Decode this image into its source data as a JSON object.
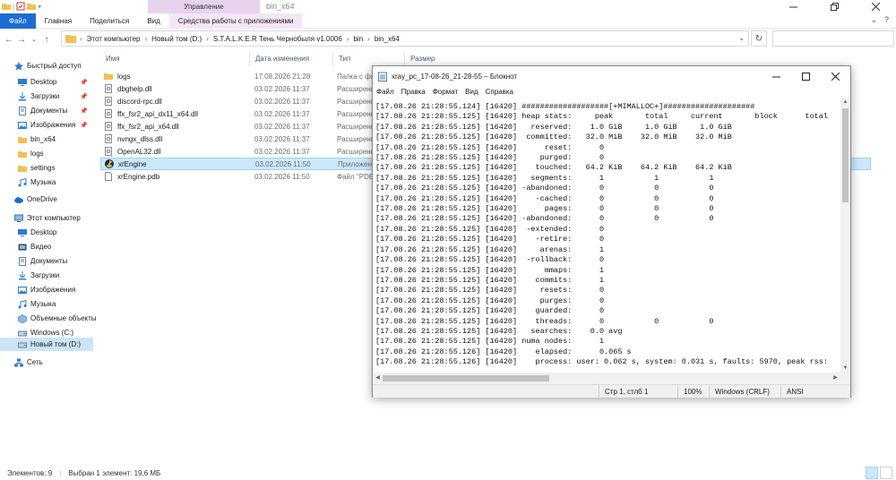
{
  "explorer": {
    "context_tab_title": "Управление",
    "window_title": "bin_x64",
    "ribbon_tabs": [
      "Файл",
      "Главная",
      "Поделиться",
      "Вид",
      "Средства работы с приложениями"
    ],
    "breadcrumb": [
      "Этот компьютер",
      "Новый том (D:)",
      "S.T.A.L.K.E.R Тень Чернобыля v1.0006",
      "bin",
      "bin_x64"
    ],
    "nav": [
      {
        "label": "Быстрый доступ",
        "icon": "star-icon",
        "pinned": false,
        "level": 0
      },
      {
        "label": "Desktop",
        "icon": "desktop-icon",
        "pinned": true,
        "level": 1
      },
      {
        "label": "Загрузки",
        "icon": "download-icon",
        "pinned": true,
        "level": 1
      },
      {
        "label": "Документы",
        "icon": "documents-icon",
        "pinned": true,
        "level": 1
      },
      {
        "label": "Изображения",
        "icon": "pictures-icon",
        "pinned": true,
        "level": 1
      },
      {
        "label": "bin_x64",
        "icon": "folder-icon",
        "pinned": false,
        "level": 1
      },
      {
        "label": "logs",
        "icon": "folder-icon",
        "pinned": false,
        "level": 1
      },
      {
        "label": "settings",
        "icon": "folder-icon",
        "pinned": false,
        "level": 1
      },
      {
        "label": "Музыка",
        "icon": "music-icon",
        "pinned": false,
        "level": 1
      },
      {
        "label": "OneDrive",
        "icon": "cloud-icon",
        "pinned": false,
        "level": 0
      },
      {
        "label": "Этот компьютер",
        "icon": "computer-icon",
        "pinned": false,
        "level": 0
      },
      {
        "label": "Desktop",
        "icon": "desktop-icon",
        "pinned": false,
        "level": 1
      },
      {
        "label": "Видео",
        "icon": "video-icon",
        "pinned": false,
        "level": 1
      },
      {
        "label": "Документы",
        "icon": "documents-icon",
        "pinned": false,
        "level": 1
      },
      {
        "label": "Загрузки",
        "icon": "download-icon",
        "pinned": false,
        "level": 1
      },
      {
        "label": "Изображения",
        "icon": "pictures-icon",
        "pinned": false,
        "level": 1
      },
      {
        "label": "Музыка",
        "icon": "music-icon",
        "pinned": false,
        "level": 1
      },
      {
        "label": "Объемные объекты",
        "icon": "3d-objects-icon",
        "pinned": false,
        "level": 1
      },
      {
        "label": "Windows (C:)",
        "icon": "drive-icon",
        "pinned": false,
        "level": 1
      },
      {
        "label": "Новый том (D:)",
        "icon": "drive-icon",
        "pinned": false,
        "level": 1,
        "selected": true
      },
      {
        "label": "Сеть",
        "icon": "network-icon",
        "pinned": false,
        "level": 0
      }
    ],
    "columns": [
      "Имя",
      "Дата изменения",
      "Тип",
      "Размер"
    ],
    "files": [
      {
        "name": "logs",
        "date": "17.08.2026 21:28",
        "type": "Папка с файлами",
        "icon": "folder-icon"
      },
      {
        "name": "dbghelp.dll",
        "date": "03.02.2026 11:37",
        "type": "Расширение приложения",
        "icon": "dll-icon"
      },
      {
        "name": "discord-rpc.dll",
        "date": "03.02.2026 11:37",
        "type": "Расширение приложения",
        "icon": "dll-icon"
      },
      {
        "name": "ffx_fsr2_api_dx11_x64.dll",
        "date": "03.02.2026 11:37",
        "type": "Расширение приложения",
        "icon": "dll-icon"
      },
      {
        "name": "ffx_fsr2_api_x64.dll",
        "date": "03.02.2026 11:37",
        "type": "Расширение приложения",
        "icon": "dll-icon"
      },
      {
        "name": "nvngx_dlss.dll",
        "date": "03.02.2026 11:37",
        "type": "Расширение приложения",
        "icon": "dll-icon"
      },
      {
        "name": "OpenAL32.dll",
        "date": "03.02.2026 11:37",
        "type": "Расширение приложения",
        "icon": "dll-icon"
      },
      {
        "name": "xrEngine",
        "date": "03.02.2026 11:50",
        "type": "Приложение",
        "icon": "radiation-icon",
        "selected": true
      },
      {
        "name": "xrEngine.pdb",
        "date": "03.02.2026 11:50",
        "type": "Файл \"PDB\"",
        "icon": "file-icon"
      }
    ],
    "status": {
      "count": "Элементов: 9",
      "selection": "Выбран 1 элемент: 19,6 МБ"
    }
  },
  "notepad": {
    "title": "xray_pc_17-08-26_21-28-55 – Блокнот",
    "menu": [
      "Файл",
      "Правка",
      "Формат",
      "Вид",
      "Справка"
    ],
    "lines": [
      "[17.08.26 21:28:55.124] [16420] ###################[+MIMALLOC+]####################",
      "[17.08.26 21:28:55.125] [16420] heap stats:     peak       total     current       block      total",
      "[17.08.26 21:28:55.125] [16420]   reserved:    1.0 GiB     1.0 GiB     1.0 GiB",
      "[17.08.26 21:28:55.125] [16420]  committed:   32.0 MiB    32.0 MiB    32.0 MiB",
      "[17.08.26 21:28:55.125] [16420]      reset:      0",
      "[17.08.26 21:28:55.125] [16420]     purged:      0",
      "[17.08.26 21:28:55.125] [16420]    touched:   64.2 KiB    64.2 KiB    64.2 KiB",
      "[17.08.26 21:28:55.125] [16420]   segments:      1           1           1",
      "[17.08.26 21:28:55.125] [16420] -abandoned:      0           0           0",
      "[17.08.26 21:28:55.125] [16420]    -cached:      0           0           0",
      "[17.08.26 21:28:55.125] [16420]      pages:      0           0           0",
      "[17.08.26 21:28:55.125] [16420] -abandoned:      0           0           0",
      "[17.08.26 21:28:55.125] [16420]  -extended:      0",
      "[17.08.26 21:28:55.125] [16420]    -retire:      0",
      "[17.08.26 21:28:55.125] [16420]     arenas:      1",
      "[17.08.26 21:28:55.125] [16420]  -rollback:      0",
      "[17.08.26 21:28:55.125] [16420]      mmaps:      1",
      "[17.08.26 21:28:55.125] [16420]    commits:      1",
      "[17.08.26 21:28:55.125] [16420]     resets:      0",
      "[17.08.26 21:28:55.125] [16420]     purges:      0",
      "[17.08.26 21:28:55.125] [16420]    guarded:      0",
      "[17.08.26 21:28:55.125] [16420]    threads:      0           0           0",
      "[17.08.26 21:28:55.125] [16420]   searches:    0.0 avg",
      "[17.08.26 21:28:55.125] [16420] numa nodes:      1",
      "[17.08.26 21:28:55.126] [16420]    elapsed:      0.065 s",
      "[17.08.26 21:28:55.126] [16420]    process: user: 0.062 s, system: 0.031 s, faults: 5970, peak rss:"
    ],
    "status": {
      "position": "Стр 1, стлб 1",
      "zoom": "100%",
      "eol": "Windows (CRLF)",
      "encoding": "ANSI"
    }
  }
}
